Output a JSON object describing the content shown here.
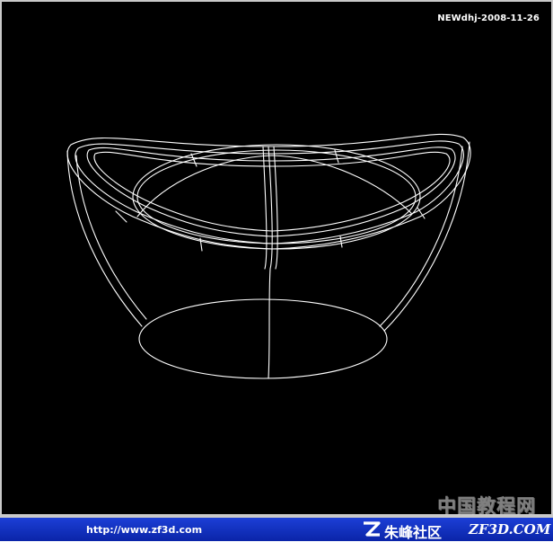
{
  "viewport": {
    "stamp": "NEWdhj-2008-11-26",
    "background": "#000000",
    "line_color": "#ffffff"
  },
  "watermark": {
    "text": "中国教程网"
  },
  "footer": {
    "url": "http://www.zf3d.com",
    "community": "朱峰社区",
    "site": "ZF3D.COM",
    "background": "#1233c4"
  }
}
